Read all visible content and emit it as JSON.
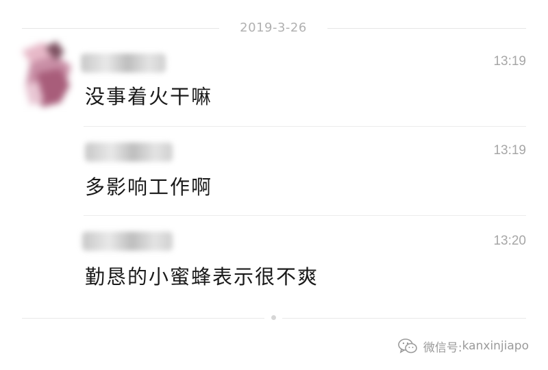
{
  "chat": {
    "date": "2019-3-26",
    "messages": [
      {
        "time": "13:19",
        "text": "没事着火干嘛"
      },
      {
        "time": "13:19",
        "text": "多影响工作啊"
      },
      {
        "time": "13:20",
        "text": "勤恳的小蜜蜂表示很不爽"
      }
    ]
  },
  "watermark": {
    "prefix": "微信号: ",
    "account": "kanxinjiapo",
    "icon": "wechat-icon"
  }
}
